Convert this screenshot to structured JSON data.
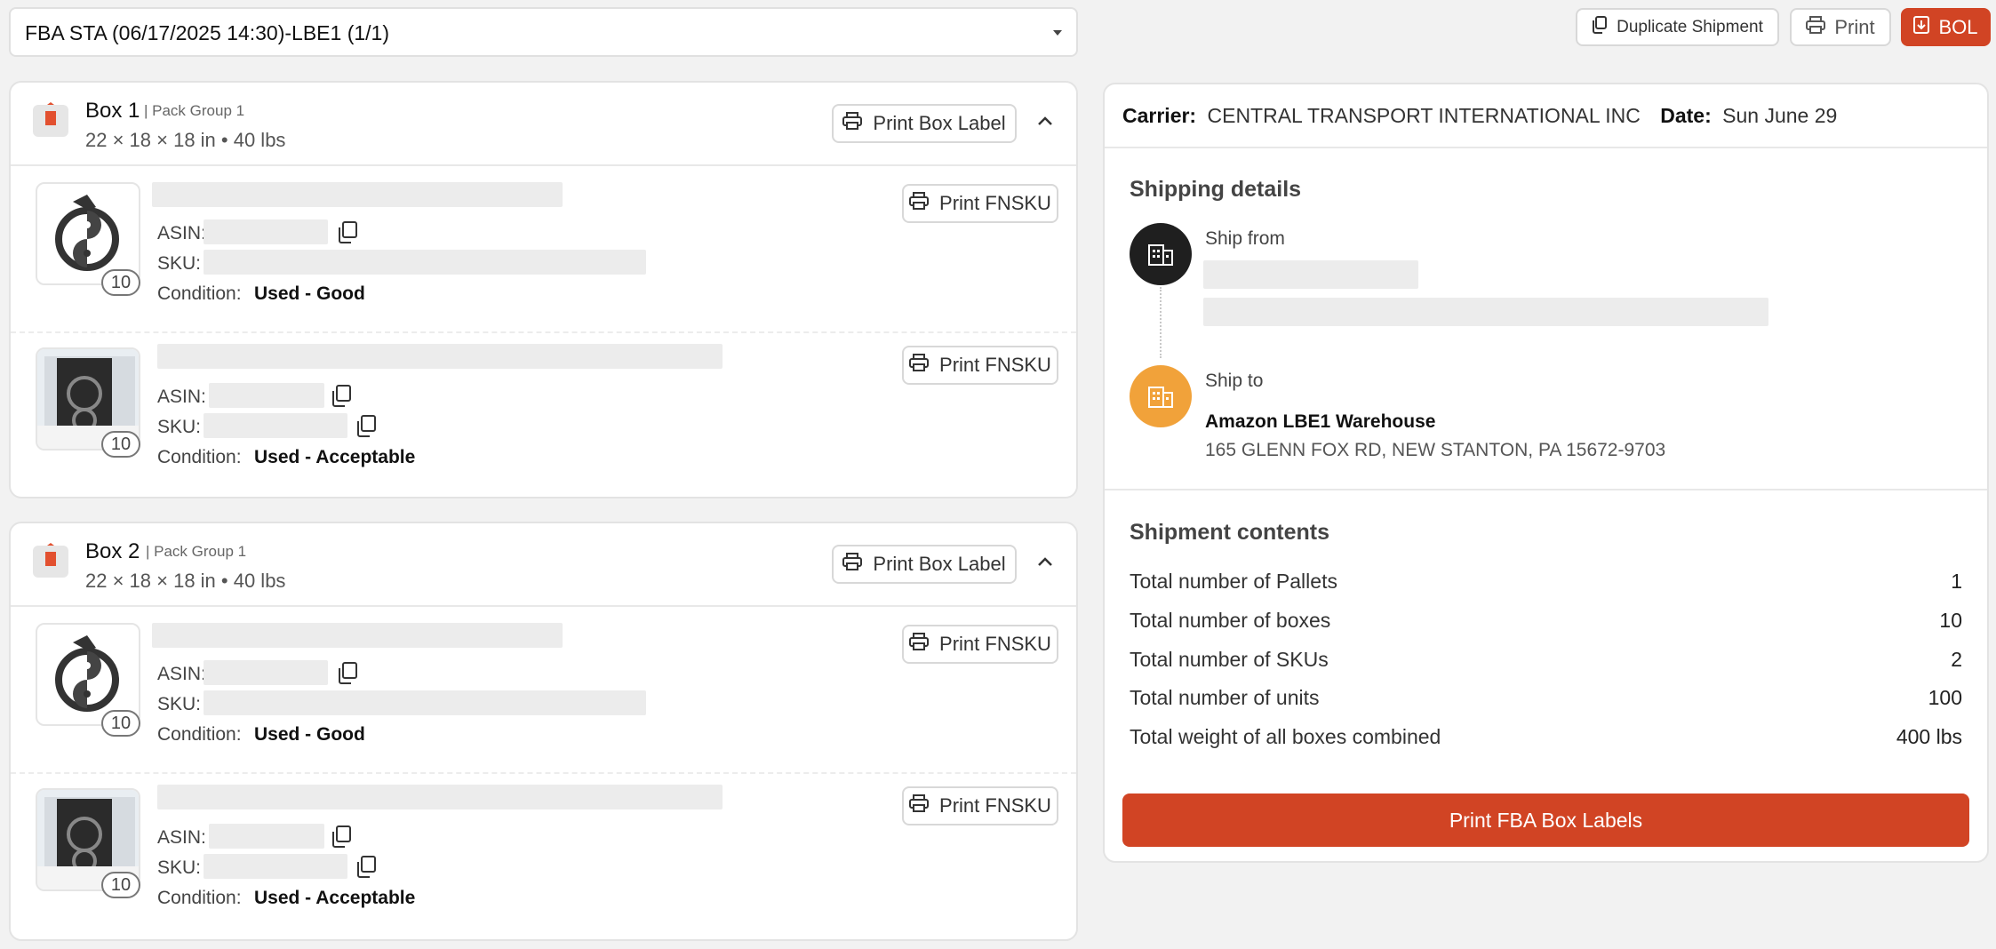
{
  "shipment_select": {
    "value": "FBA STA (06/17/2025 14:30)-LBE1 (1/1)"
  },
  "toolbar": {
    "duplicate_label": "Duplicate Shipment",
    "print_label": "Print",
    "bol_label": "BOL"
  },
  "boxes": [
    {
      "title": "Box 1",
      "pack_group": "| Pack Group 1",
      "dims": "22 × 18 × 18 in • 40 lbs",
      "print_label": "Print Box Label",
      "items": [
        {
          "qty": "10",
          "asin_label": "ASIN:",
          "sku_label": "SKU:",
          "condition_label": "Condition:",
          "condition": "Used - Good",
          "print_fnsku": "Print FNSKU"
        },
        {
          "qty": "10",
          "asin_label": "ASIN:",
          "sku_label": "SKU:",
          "condition_label": "Condition:",
          "condition": "Used - Acceptable",
          "print_fnsku": "Print FNSKU"
        }
      ]
    },
    {
      "title": "Box 2",
      "pack_group": "| Pack Group 1",
      "dims": "22 × 18 × 18 in • 40 lbs",
      "print_label": "Print Box Label",
      "items": [
        {
          "qty": "10",
          "asin_label": "ASIN:",
          "sku_label": "SKU:",
          "condition_label": "Condition:",
          "condition": "Used - Good",
          "print_fnsku": "Print FNSKU"
        },
        {
          "qty": "10",
          "asin_label": "ASIN:",
          "sku_label": "SKU:",
          "condition_label": "Condition:",
          "condition": "Used - Acceptable",
          "print_fnsku": "Print FNSKU"
        }
      ]
    }
  ],
  "details": {
    "carrier_label": "Carrier:",
    "carrier": "CENTRAL TRANSPORT INTERNATIONAL INC",
    "date_label": "Date:",
    "date": "Sun June 29",
    "shipping_title": "Shipping details",
    "ship_from_label": "Ship from",
    "ship_to_label": "Ship to",
    "ship_to_name": "Amazon LBE1 Warehouse",
    "ship_to_address": "165 GLENN FOX RD, NEW STANTON, PA 15672-9703",
    "contents_title": "Shipment contents",
    "rows": [
      {
        "label": "Total number of Pallets",
        "value": "1"
      },
      {
        "label": "Total number of boxes",
        "value": "10"
      },
      {
        "label": "Total number of SKUs",
        "value": "2"
      },
      {
        "label": "Total number of units",
        "value": "100"
      },
      {
        "label": "Total weight of all boxes combined",
        "value": "400 lbs"
      }
    ],
    "print_fba_label": "Print FBA Box Labels"
  },
  "colors": {
    "accent": "#d14424",
    "ship_from_icon": "#1f1f1f",
    "ship_to_icon": "#f1a23a"
  }
}
